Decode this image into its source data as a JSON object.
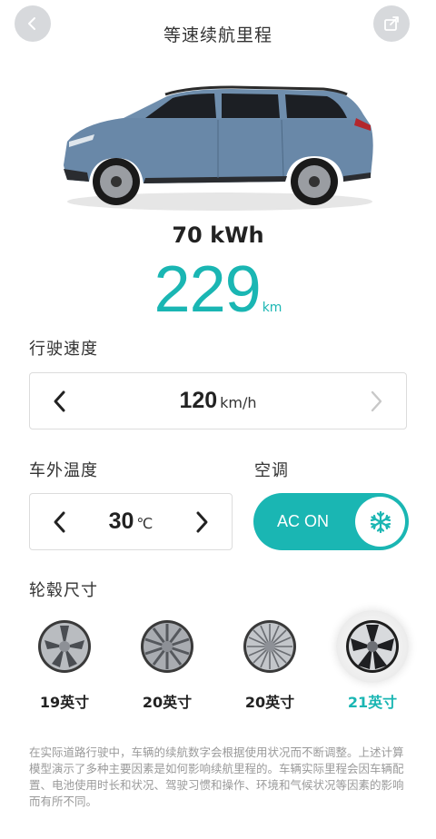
{
  "header": {
    "title": "等速续航里程"
  },
  "summary": {
    "battery": "70 kWh",
    "range_value": "229",
    "range_unit": "km"
  },
  "speed": {
    "label": "行驶速度",
    "value": "120",
    "unit": "km/h"
  },
  "temperature": {
    "label": "车外温度",
    "value": "30",
    "unit": "℃"
  },
  "ac": {
    "label": "空调",
    "state_label": "AC ON"
  },
  "wheels": {
    "label": "轮毂尺寸",
    "options": [
      {
        "label": "19英寸",
        "selected": false
      },
      {
        "label": "20英寸",
        "selected": false
      },
      {
        "label": "20英寸",
        "selected": false
      },
      {
        "label": "21英寸",
        "selected": true
      }
    ]
  },
  "footnote": "在实际道路行驶中，车辆的续航数字会根据使用状况而不断调整。上述计算模型演示了多种主要因素是如何影响续航里程的。车辆实际里程会因车辆配置、电池使用时长和状况、驾驶习惯和操作、环境和气候状况等因素的影响而有所不同。",
  "colors": {
    "accent": "#1ab6b3",
    "button_bg": "#d7d9dc",
    "border": "#dcdcdc"
  },
  "icons": {
    "back": "chevron-left-icon",
    "share": "share-icon",
    "snowflake": "snowflake-icon"
  }
}
